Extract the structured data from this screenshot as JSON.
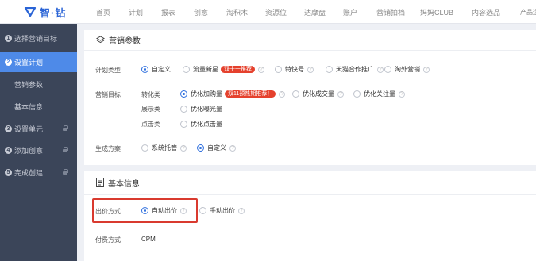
{
  "header": {
    "logo_text": "智·钻",
    "nav": [
      "首页",
      "计划",
      "报表",
      "创意",
      "淘积木",
      "资源位",
      "达摩盘",
      "账户",
      "营销拍档",
      "妈妈CLUB",
      "内容选品",
      "产品运"
    ]
  },
  "sidebar": {
    "items": [
      {
        "num": "1",
        "label": "选择营销目标"
      },
      {
        "num": "2",
        "label": "设置计划"
      },
      {
        "label": "营销参数"
      },
      {
        "label": "基本信息"
      },
      {
        "num": "3",
        "label": "设置单元"
      },
      {
        "num": "4",
        "label": "添加创意"
      },
      {
        "num": "5",
        "label": "完成创建"
      }
    ]
  },
  "section1": {
    "title": "营销参数",
    "plan_type_label": "计划类型",
    "plan_types": [
      "自定义",
      "流量新星",
      "特快号",
      "天猫合作推广",
      "淘外营销"
    ],
    "plan_type_badge": "双十一推荐",
    "goal_label": "营销目标",
    "goal_rows": [
      {
        "category": "转化类",
        "options": [
          "优化加购量",
          "优化成交量",
          "优化关注量"
        ],
        "badge": "双11预热期推荐！"
      },
      {
        "category": "展示类",
        "options": [
          "优化曝光量"
        ]
      },
      {
        "category": "点击类",
        "options": [
          "优化点击量"
        ]
      }
    ],
    "scheme_label": "生成方案",
    "schemes": [
      "系统托管",
      "自定义"
    ]
  },
  "section2": {
    "title": "基本信息",
    "bid_label": "出价方式",
    "bid_options": [
      "自动出价",
      "手动出价"
    ],
    "pay_label": "付费方式",
    "pay_value": "CPM"
  },
  "colors": {
    "accent": "#2f6fde",
    "sidebar": "#3b4559",
    "active": "#4e8ae8",
    "badge": "#e5412d",
    "highlight": "#d93a2f"
  }
}
